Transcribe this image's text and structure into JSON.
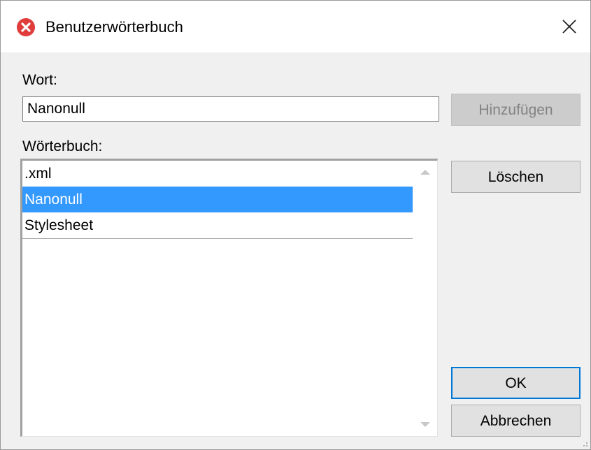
{
  "window": {
    "title": "Benutzerwörterbuch",
    "icon": "altova-red-x-icon",
    "close_glyph": "×"
  },
  "word": {
    "label": "Wort:",
    "value": "Nanonull"
  },
  "dictionary": {
    "label": "Wörterbuch:",
    "items": [
      {
        "label": ".xml",
        "selected": false
      },
      {
        "label": "Nanonull",
        "selected": true
      },
      {
        "label": "Stylesheet",
        "selected": false
      }
    ]
  },
  "buttons": {
    "add": "Hinzufügen",
    "delete": "Löschen",
    "ok": "OK",
    "cancel": "Abbrechen"
  },
  "colors": {
    "selection": "#3399ff",
    "focus_border": "#0078d7",
    "icon_red": "#e03c3c"
  }
}
